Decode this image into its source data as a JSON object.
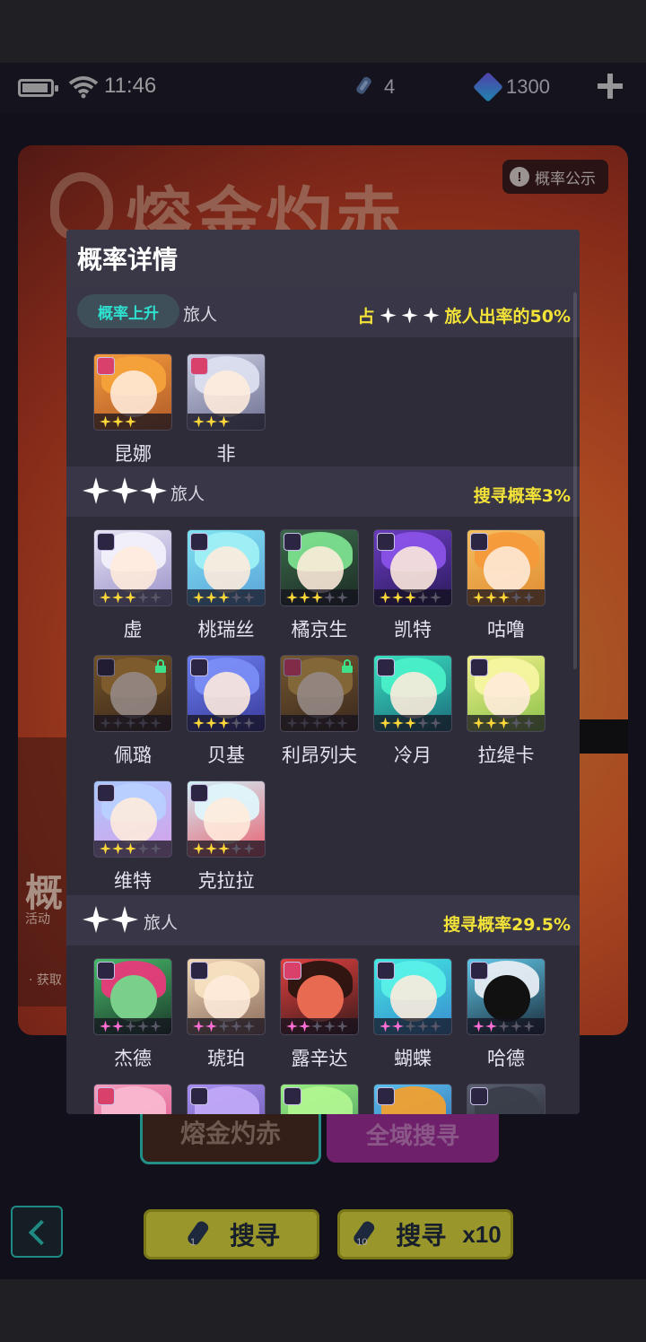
{
  "status_bar": {
    "time": "11:46",
    "keys": "4",
    "gems": "1300"
  },
  "banner": {
    "title": "熔金灼赤",
    "prob_public": "概率公示",
    "left_big": "概",
    "left_small": "活动",
    "left_bullet": "· 获取"
  },
  "tabs": {
    "tab_a": "熔金灼赤",
    "tab_b": "全域搜寻"
  },
  "bottom": {
    "search_label": "搜寻",
    "search10_label": "搜寻",
    "multiplier": "x10",
    "ticket_1": "1",
    "ticket_10": "10"
  },
  "modal": {
    "title": "概率详情",
    "up_section": {
      "pill": "概率上升",
      "name": "旅人",
      "right_prefix": "占",
      "right_suffix": "旅人出率的50%",
      "chars": [
        "昆娜",
        "非"
      ]
    },
    "three_star": {
      "name": "旅人",
      "rate": "搜寻概率3%",
      "chars": [
        "虚",
        "桃瑞丝",
        "橘京生",
        "凯特",
        "咕噜",
        "佩璐",
        "贝基",
        "利昂列夫",
        "冷月",
        "拉缇卡",
        "维特",
        "克拉拉"
      ]
    },
    "two_star": {
      "name": "旅人",
      "rate": "搜寻概率29.5%",
      "chars": [
        "杰德",
        "琥珀",
        "露辛达",
        "蝴蝶",
        "哈德"
      ]
    }
  },
  "colors": {
    "accent_yellow": "#f3e338",
    "accent_teal": "#2ee0cf",
    "modal_bg": "#2e2c38"
  }
}
